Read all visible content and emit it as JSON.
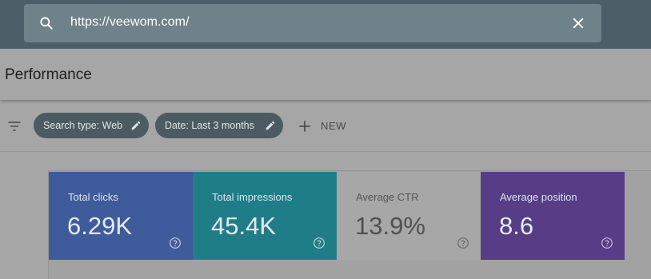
{
  "search": {
    "value": "https://veewom.com/",
    "icon": "search-icon",
    "clear_icon": "close-icon"
  },
  "page": {
    "title": "Performance"
  },
  "filters": {
    "icon": "filter-icon",
    "chips": [
      {
        "label": "Search type: Web",
        "icon": "edit-icon"
      },
      {
        "label": "Date: Last 3 months",
        "icon": "edit-icon"
      }
    ],
    "new_label": "NEW",
    "new_icon": "plus-icon"
  },
  "metrics": [
    {
      "label": "Total clicks",
      "value": "6.29K",
      "color": "#3f5b9c",
      "selected": true
    },
    {
      "label": "Total impressions",
      "value": "45.4K",
      "color": "#1f7d88",
      "selected": true
    },
    {
      "label": "Average CTR",
      "value": "13.9%",
      "color": "#a7a7a7",
      "selected": false
    },
    {
      "label": "Average position",
      "value": "8.6",
      "color": "#563d85",
      "selected": true
    }
  ],
  "colors": {
    "topbar": "#4c5f69",
    "overlay": "#a6a6a6"
  }
}
